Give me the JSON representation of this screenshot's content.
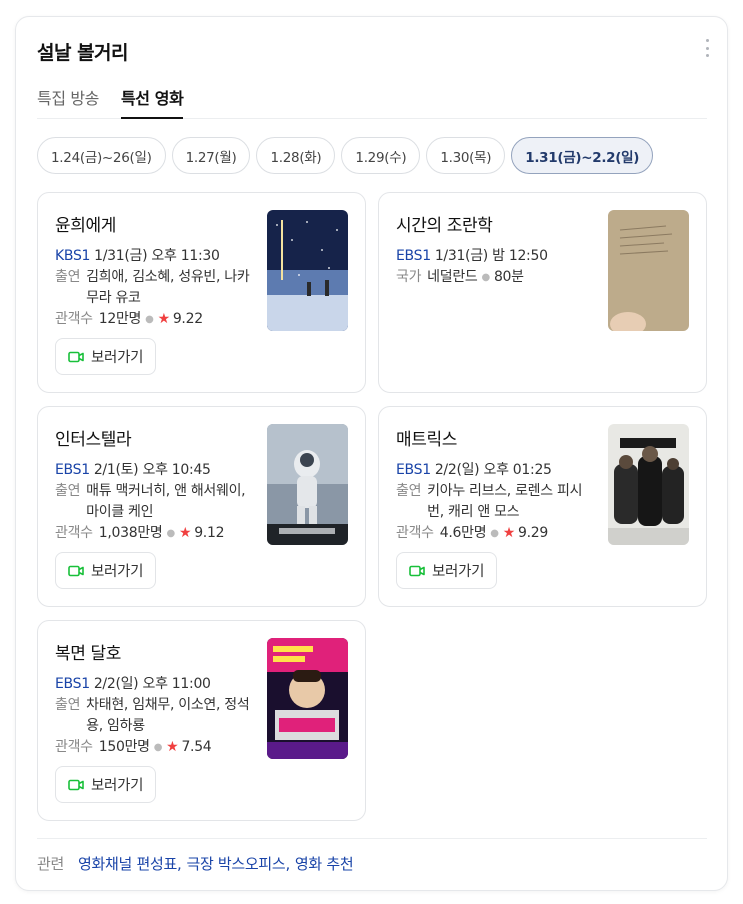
{
  "panel": {
    "title": "설날 볼거리"
  },
  "tabs": [
    {
      "label": "특집 방송",
      "active": false
    },
    {
      "label": "특선 영화",
      "active": true
    }
  ],
  "date_chips": [
    {
      "label": "1.24(금)~26(일)",
      "active": false
    },
    {
      "label": "1.27(월)",
      "active": false
    },
    {
      "label": "1.28(화)",
      "active": false
    },
    {
      "label": "1.29(수)",
      "active": false
    },
    {
      "label": "1.30(목)",
      "active": false
    },
    {
      "label": "1.31(금)~2.2(일)",
      "active": true
    }
  ],
  "labels": {
    "cast": "출연",
    "audience": "관객수",
    "country": "국가",
    "watch": "보러가기",
    "related": "관련"
  },
  "movies": [
    {
      "title": "윤희에게",
      "channel": "KBS1",
      "time": "1/31(금) 오후 11:30",
      "cast": "김희애, 김소혜, 성유빈, 나카무라 유코",
      "audience": "12만명",
      "rating": "9.22"
    },
    {
      "title": "시간의 조란학",
      "channel": "EBS1",
      "time": "1/31(금) 밤 12:50",
      "country": "네덜란드",
      "duration": "80분"
    },
    {
      "title": "인터스텔라",
      "channel": "EBS1",
      "time": "2/1(토) 오후 10:45",
      "cast": "매튜 맥커너히, 앤 해서웨이, 마이클 케인",
      "audience": "1,038만명",
      "rating": "9.12"
    },
    {
      "title": "매트릭스",
      "channel": "EBS1",
      "time": "2/2(일) 오후 01:25",
      "cast": "키아누 리브스, 로렌스 피시번, 캐리 앤 모스",
      "audience": "4.6만명",
      "rating": "9.29"
    },
    {
      "title": "복면 달호",
      "channel": "EBS1",
      "time": "2/2(일) 오후 11:00",
      "cast": "차태현, 임채무, 이소연, 정석용, 임하룡",
      "audience": "150만명",
      "rating": "7.54"
    }
  ],
  "related": {
    "links": [
      "영화채널 편성표",
      "극장 박스오피스",
      "영화 추천"
    ]
  },
  "icons": {
    "watch": "video-camera-icon",
    "more": "more-vertical-icon",
    "star": "star-icon"
  },
  "colors": {
    "channel": "#1a44a8",
    "star": "#f04040",
    "video_icon": "#19c03a"
  }
}
